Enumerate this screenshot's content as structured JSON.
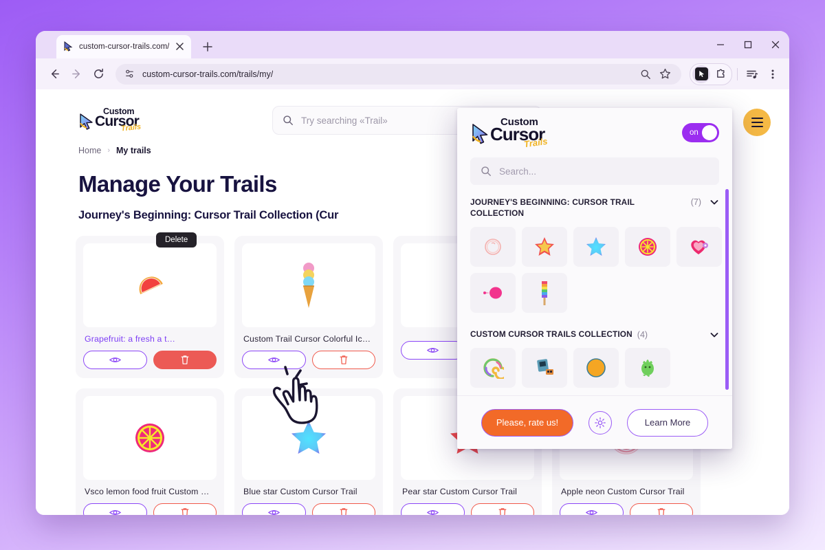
{
  "browser": {
    "tab": {
      "title": "custom-cursor-trails.com/trails/",
      "favicon_icon": "custom-cursor-favicon",
      "close_icon": "close-icon"
    },
    "new_tab_label": "+",
    "window_controls": {
      "minimize": "minimize-icon",
      "maximize": "maximize-icon",
      "close": "close-icon"
    },
    "nav": {
      "back": "back-arrow-icon",
      "forward": "forward-arrow-icon",
      "reload": "reload-icon"
    },
    "omnibox": {
      "site_icon": "site-settings-icon",
      "url": "custom-cursor-trails.com/trails/my/",
      "search_icon": "search-icon",
      "bookmark_icon": "star-icon"
    },
    "extensions": {
      "active_icon": "custom-cursor-extension-icon",
      "puzzle_icon": "extensions-puzzle-icon"
    },
    "media_icon": "media-playlist-icon",
    "menu_icon": "three-dot-menu-icon"
  },
  "site": {
    "brand": {
      "custom": "Custom",
      "cursor": "Cursor",
      "trails": "Trails",
      "logo_icon": "cursor-arrow-logo"
    },
    "search": {
      "placeholder": "Try searching «Trail»",
      "icon": "search-icon"
    },
    "menu_icon": "hamburger-menu-icon",
    "breadcrumb": {
      "home": "Home",
      "separator": "›",
      "current": "My trails"
    },
    "title": "Manage Your Trails",
    "subtitle": "Journey's Beginning: Cursor Trail Collection (Cur",
    "tooltip": "Delete",
    "actions": {
      "view_icon": "eye-icon",
      "delete_icon": "trash-icon"
    },
    "cards": [
      {
        "title": "Grapefruit: a fresh a          t…",
        "thumb": "grapefruit-slice",
        "highlighted": true,
        "delete_active": true
      },
      {
        "title": "Custom Trail Cursor Colorful Ic…",
        "thumb": "rainbow-ice-cream",
        "highlighted": false,
        "delete_active": false
      },
      {
        "title": "",
        "thumb": "hidden-behind-popup",
        "highlighted": false,
        "delete_active": false
      },
      {
        "title": "",
        "thumb": "hidden-behind-popup",
        "highlighted": false,
        "delete_active": false
      },
      {
        "title": "Vsco lemon food fruit Custom …",
        "thumb": "pink-lemon-slice",
        "highlighted": false,
        "delete_active": false
      },
      {
        "title": "Blue star Custom Cursor Trail",
        "thumb": "blue-star",
        "highlighted": false,
        "delete_active": false
      },
      {
        "title": "Pear star Custom Cursor Trail",
        "thumb": "yellow-pear-star",
        "highlighted": false,
        "delete_active": false
      },
      {
        "title": "Apple neon Custom Cursor Trail",
        "thumb": "neon-apple-ring",
        "highlighted": false,
        "delete_active": false
      }
    ]
  },
  "popup": {
    "brand": {
      "custom": "Custom",
      "cursor": "Cursor",
      "trails": "Trails",
      "logo_icon": "cursor-arrow-logo"
    },
    "toggle": {
      "label": "on",
      "state": "on",
      "color": "#9b2df0"
    },
    "search": {
      "placeholder": "Search...",
      "icon": "search-icon"
    },
    "sections": [
      {
        "title": "JOURNEY'S BEGINNING: CURSOR TRAIL COLLECTION",
        "count": "(7)",
        "chevron_icon": "chevron-down-icon",
        "items": [
          "peach-outline",
          "yellow-star",
          "blue-star",
          "pink-citrus",
          "pink-heart-flower",
          "pink-balloon",
          "rainbow-popsicle"
        ]
      },
      {
        "title": "CUSTOM CURSOR TRAILS COLLECTION",
        "count": "(4)",
        "chevron_icon": "chevron-down-icon",
        "items": [
          "rainbow-swirl",
          "retro-gameboy",
          "moon-crescent",
          "green-monster"
        ]
      }
    ],
    "footer": {
      "rate_label": "Please, rate us!",
      "rate_color": "#f26a28",
      "settings_icon": "gear-icon",
      "learn_label": "Learn More"
    },
    "scrollbar_color": "#9b5cf6"
  },
  "cursor": {
    "icon": "pointing-hand-cursor"
  }
}
